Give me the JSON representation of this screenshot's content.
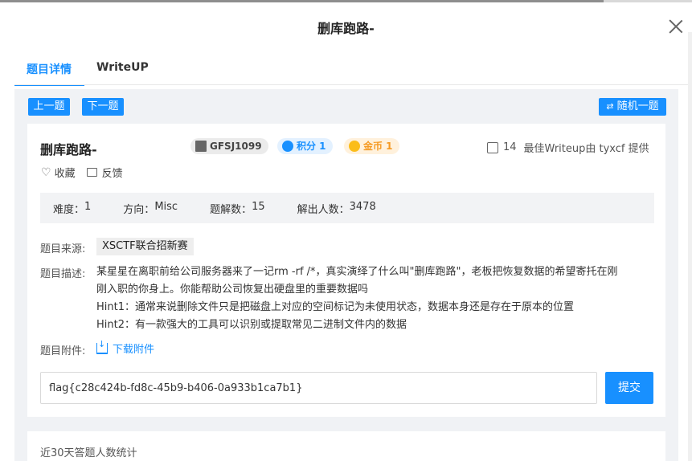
{
  "dialog": {
    "title": "删库跑路-"
  },
  "tabs": [
    {
      "label": "题目详情",
      "active": true
    },
    {
      "label": "WriteUP",
      "active": false
    }
  ],
  "nav": {
    "prev_label": "上一题",
    "next_label": "下一题",
    "random_label": "随机一题"
  },
  "task": {
    "title": "删库跑路-",
    "id_badge": "GFSJ1099",
    "score_badge": "积分 1",
    "coin_badge": "金币 1",
    "likes": "14",
    "writeup_credit": "最佳Writeup由 tyxcf 提供",
    "favorite_label": "收藏",
    "feedback_label": "反馈"
  },
  "stats": {
    "difficulty_label": "难度：",
    "difficulty": "1",
    "direction_label": "方向：",
    "direction": "Misc",
    "solves_label": "题解数：",
    "solves": "15",
    "solvers_label": "解出人数：",
    "solvers": "3478"
  },
  "source": {
    "label": "题目来源:",
    "value": "XSCTF联合招新赛"
  },
  "description": {
    "label": "题目描述:",
    "lines": [
      "某星星在离职前给公司服务器来了一记rm -rf /*，真实演绎了什么叫\"删库跑路\"，老板把恢复数据的希望寄托在刚",
      "刚入职的你身上。你能帮助公司恢复出硬盘里的重要数据吗",
      "Hint1：通常来说删除文件只是把磁盘上对应的空间标记为未使用状态，数据本身还是存在于原本的位置",
      "Hint2：有一款强大的工具可以识别或提取常见二进制文件内的数据"
    ]
  },
  "attachment": {
    "label": "题目附件:",
    "download_label": "下载附件"
  },
  "flag": {
    "value": "flag{c28c424b-fd8c-45b9-b406-0a933b1ca7b1}",
    "submit_label": "提交"
  },
  "recent": {
    "title": "近30天答题人数统计"
  },
  "colors": {
    "accent": "#1890ff",
    "panel_bg": "#f0f2f5",
    "coin": "#f59a23"
  }
}
